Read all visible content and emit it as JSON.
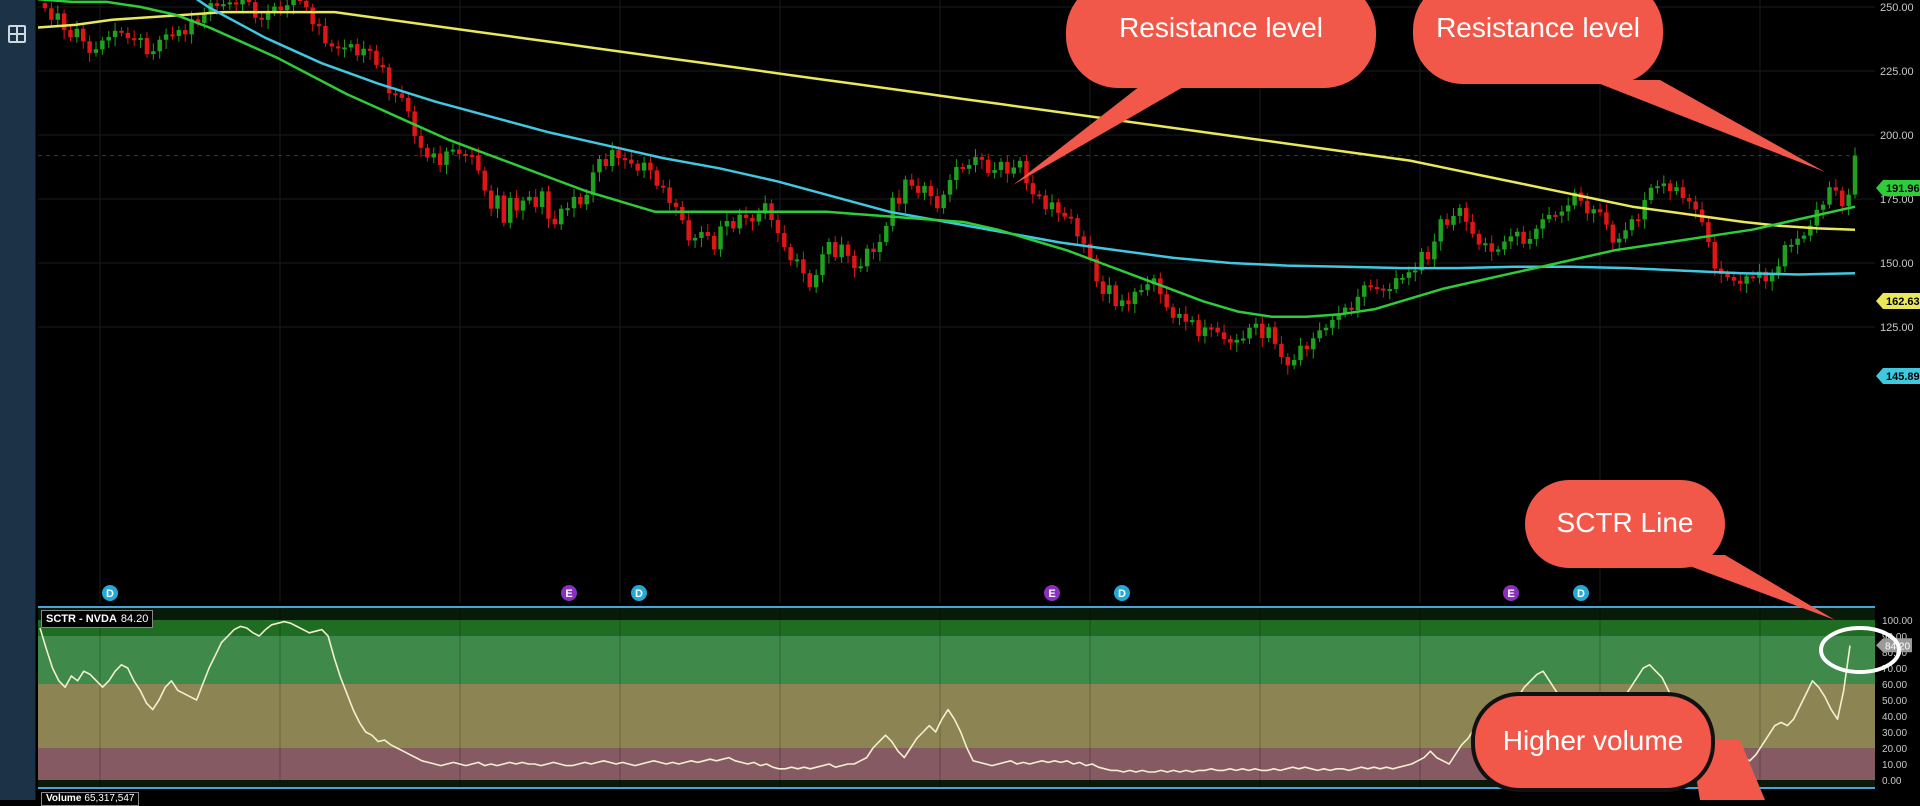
{
  "chart_data": [
    {
      "type": "candlestick",
      "title": "",
      "xlabel": "",
      "ylabel": "",
      "ylim": [
        106,
        255
      ],
      "y_ticks": [
        {
          "value": 250,
          "label": "250.00"
        },
        {
          "value": 225,
          "label": "225.00"
        },
        {
          "value": 200,
          "label": "200.00"
        },
        {
          "value": 175,
          "label": "175.00"
        },
        {
          "value": 150,
          "label": "150.00"
        },
        {
          "value": 125,
          "label": "125.00"
        }
      ],
      "candles_close": [
        249.5,
        245.0,
        247.5,
        241.0,
        238.2,
        241.5,
        236.6,
        232.1,
        233.5,
        236.9,
        238.3,
        240.7,
        239.9,
        237.8,
        237.6,
        237.9,
        231.6,
        232.7,
        237.2,
        239.3,
        238.7,
        241.0,
        239.3,
        245.2,
        243.8,
        247.4,
        251.5,
        250.4,
        251.1,
        251.8,
        251.0,
        253.3,
        251.9,
        245.8,
        245.0,
        247.9,
        250.2,
        248.8,
        250.7,
        253.1,
        252.4,
        249.8,
        243.3,
        242.6,
        235.8,
        234.6,
        233.9,
        234.2,
        235.5,
        231.1,
        233.7,
        232.9,
        227.4,
        226.4,
        216.3,
        216.2,
        214.5,
        209.2,
        199.6,
        195.0,
        191.2,
        192.8,
        188.3,
        193.6,
        194.3,
        192.6,
        192.2,
        192.0,
        186.1,
        178.3,
        171.2,
        176.4,
        165.7,
        175.4,
        170.5,
        174.4,
        175.8,
        171.9,
        178.0,
        167.3,
        165.1,
        171.2,
        171.4,
        175.8,
        172.9,
        176.6,
        185.4,
        190.6,
        187.9,
        194.1,
        191.0,
        190.4,
        188.8,
        186.1,
        189.2,
        186.2,
        180.2,
        179.5,
        173.5,
        171.9,
        166.7,
        158.8,
        159.8,
        162.1,
        160.6,
        155.3,
        164.3,
        166.4,
        163.5,
        168.9,
        167.6,
        166.2,
        169.3,
        173.3,
        166.8,
        161.7,
        156.2,
        151.1,
        151.4,
        146.0,
        140.5,
        145.3,
        153.4,
        158.2,
        152.3,
        157.2,
        152.8,
        148.0,
        148.7,
        155.6,
        154.3,
        158.2,
        164.5,
        175.5,
        173.2,
        182.6,
        180.2,
        177.4,
        180.1,
        176.1,
        171.4,
        176.7,
        182.4,
        187.5,
        186.8,
        188.3,
        191.4,
        190.3,
        185.2,
        186.3,
        189.5,
        184.9,
        187.3,
        189.9,
        181.2,
        176.8,
        176.4,
        171.0,
        173.7,
        169.6,
        168.1,
        167.5,
        160.4,
        157.5,
        151.7,
        142.8,
        137.9,
        141.3,
        133.2,
        135.4,
        134.0,
        138.8,
        139.4,
        141.7,
        144.0,
        137.8,
        132.7,
        128.6,
        130.1,
        127.1,
        127.7,
        121.5,
        124.8,
        124.7,
        122.9,
        120.3,
        118.9,
        120.0,
        120.5,
        124.7,
        126.3,
        120.7,
        124.9,
        118.4,
        113.3,
        110.0,
        112.1,
        117.7,
        116.3,
        120.6,
        123.7,
        124.7,
        127.8,
        130.2,
        132.6,
        131.6,
        136.8,
        141.3,
        140.6,
        140.0,
        139.4,
        139.8,
        144.1,
        144.2,
        146.4,
        147.1,
        154.3,
        151.4,
        158.4,
        167.1,
        164.9,
        168.4,
        171.5,
        166.1,
        161.4,
        157.2,
        157.7,
        154.4,
        155.3,
        158.4,
        160.4,
        162.2,
        157.5,
        159.4,
        163.4,
        167.1,
        168.8,
        168.5,
        170.1,
        172.5,
        177.5,
        174.3,
        169.4,
        171.0,
        169.8,
        165.0,
        158.0,
        159.5,
        162.8,
        167.1,
        167.0,
        174.6,
        179.4,
        180.0,
        181.1,
        178.1,
        179.6,
        175.4,
        174.0,
        170.9,
        165.9,
        158.2,
        147.8,
        145.7,
        144.5,
        143.1,
        141.9,
        144.8,
        144.2,
        146.6,
        142.8,
        145.3,
        148.7,
        157.0,
        157.1,
        159.5,
        160.7,
        164.6,
        170.8,
        172.8,
        179.6,
        178.3,
        172.2,
        176.7,
        192.0
      ],
      "series": [
        {
          "name": "",
          "color": "#e8e85a",
          "values": [
            242,
            243,
            245,
            246,
            247,
            248,
            248,
            248,
            248,
            246,
            244,
            242,
            240,
            238,
            236,
            234,
            232,
            230,
            228,
            226,
            224,
            222,
            220,
            218,
            216,
            214,
            212,
            210,
            208,
            206,
            204,
            202,
            200,
            198,
            196,
            194,
            192,
            190,
            187,
            184,
            181,
            178,
            175,
            172,
            170,
            168,
            166,
            164.5,
            163.5,
            163
          ]
        },
        {
          "name": "",
          "color": "#3fc8e0",
          "values": [
            300,
            285,
            265,
            250,
            238,
            228,
            220,
            213,
            207,
            201,
            196,
            191,
            187,
            182,
            176,
            170,
            166,
            162,
            158,
            155,
            152,
            150,
            149,
            148.5,
            148,
            148,
            148.5,
            148.5,
            148,
            147,
            146,
            145.5,
            146
          ]
        },
        {
          "name": "",
          "color": "#2ecc3a",
          "values": [
            253,
            252,
            252,
            250,
            247,
            242,
            236,
            230,
            223,
            216,
            210,
            204,
            198,
            193,
            188,
            183,
            178,
            174,
            170,
            170,
            170,
            170,
            170,
            170,
            169,
            168,
            167,
            166,
            163,
            159,
            155,
            150,
            145,
            140,
            135,
            131,
            129,
            129,
            130,
            132,
            136,
            140,
            143,
            146,
            149,
            152,
            155,
            157,
            159,
            161,
            163,
            166,
            169,
            172
          ]
        }
      ],
      "right_tags": [
        {
          "label": "191.96",
          "color": "#2ecc3a",
          "value": 191.96
        },
        {
          "label": "162.63",
          "color": "#e8e85a",
          "value": 162.63
        },
        {
          "label": "145.89",
          "color": "#3fc8e0",
          "value": 145.89
        }
      ],
      "event_markers": [
        {
          "label": "D",
          "color": "#23a9d6"
        },
        {
          "label": "E",
          "color": "#8a2fc0"
        },
        {
          "label": "D",
          "color": "#23a9d6"
        },
        {
          "label": "E",
          "color": "#8a2fc0"
        },
        {
          "label": "D",
          "color": "#23a9d6"
        },
        {
          "label": "E",
          "color": "#8a2fc0"
        },
        {
          "label": "D",
          "color": "#23a9d6"
        }
      ],
      "callouts": [
        {
          "text": "Resistance level"
        },
        {
          "text": "Resistance level"
        }
      ]
    },
    {
      "type": "line",
      "title": "SCTR - NVDA",
      "current_value": "84.20",
      "ylim": [
        0,
        100
      ],
      "y_ticks": [
        "100.00",
        "90.00",
        "80.00",
        "70.00",
        "60.00",
        "50.00",
        "40.00",
        "30.00",
        "20.00",
        "10.00",
        "0.00"
      ],
      "current_tag": "84.20",
      "zones": [
        {
          "from": 90,
          "to": 100,
          "color": "#1f6d22"
        },
        {
          "from": 60,
          "to": 90,
          "color": "#3f8a4a"
        },
        {
          "from": 20,
          "to": 60,
          "color": "#8c8452"
        },
        {
          "from": 0,
          "to": 20,
          "color": "#855a62"
        }
      ],
      "values": [
        95,
        82,
        70,
        62,
        58,
        65,
        62,
        68,
        66,
        62,
        58,
        62,
        68,
        72,
        70,
        62,
        56,
        48,
        44,
        50,
        58,
        62,
        56,
        54,
        52,
        50,
        60,
        70,
        78,
        86,
        90,
        94,
        96,
        95,
        92,
        90,
        94,
        97,
        98,
        99,
        98,
        96,
        94,
        92,
        93,
        94,
        90,
        76,
        64,
        54,
        44,
        36,
        30,
        28,
        24,
        25,
        22,
        20,
        18,
        16,
        14,
        12,
        11,
        10,
        9,
        10,
        11,
        10,
        9,
        10,
        11,
        9,
        10,
        9,
        10,
        11,
        10,
        11,
        10,
        10,
        9,
        10,
        11,
        10,
        9,
        9,
        10,
        11,
        10,
        11,
        12,
        11,
        10,
        11,
        10,
        9,
        10,
        11,
        12,
        11,
        10,
        11,
        10,
        11,
        12,
        11,
        12,
        13,
        12,
        13,
        14,
        12,
        11,
        10,
        11,
        9,
        10,
        8,
        7,
        7,
        8,
        7,
        8,
        7,
        8,
        9,
        10,
        8,
        9,
        10,
        10,
        12,
        14,
        20,
        24,
        28,
        24,
        18,
        14,
        20,
        26,
        30,
        34,
        30,
        38,
        44,
        38,
        30,
        20,
        12,
        11,
        10,
        9,
        10,
        11,
        12,
        10,
        11,
        10,
        11,
        12,
        11,
        12,
        11,
        12,
        10,
        11,
        9,
        10,
        8,
        7,
        6,
        6,
        5,
        6,
        5,
        6,
        5,
        5,
        6,
        5,
        6,
        5,
        6,
        5,
        6,
        6,
        7,
        6,
        6,
        7,
        6,
        7,
        6,
        7,
        6,
        6,
        7,
        6,
        7,
        8,
        7,
        8,
        7,
        6,
        7,
        6,
        7,
        7,
        6,
        7,
        8,
        7,
        8,
        7,
        8,
        7,
        8,
        9,
        10,
        12,
        14,
        18,
        14,
        12,
        10,
        16,
        22,
        26,
        32,
        38,
        34,
        32,
        30,
        38,
        46,
        52,
        58,
        62,
        66,
        68,
        62,
        56,
        50,
        44,
        40,
        36,
        32,
        30,
        34,
        38,
        42,
        46,
        52,
        58,
        64,
        70,
        72,
        68,
        64,
        56,
        48,
        40,
        34,
        30,
        26,
        22,
        18,
        14,
        12,
        14,
        16,
        14,
        12,
        16,
        22,
        28,
        34,
        36,
        34,
        38,
        46,
        54,
        62,
        58,
        52,
        44,
        38,
        56,
        84
      ]
    },
    {
      "type": "bar",
      "title": "Volume",
      "current_value": "65,317,547"
    }
  ],
  "annotations": {
    "sctr_callout": "SCTR Line",
    "volume_callout": "Higher volume"
  },
  "left_rail": {
    "icon": "grid-plus-icon"
  }
}
